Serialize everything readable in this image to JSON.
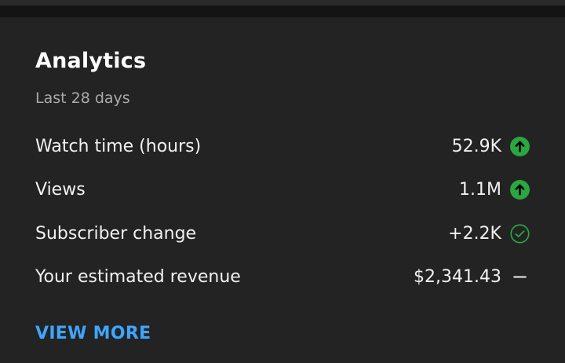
{
  "card": {
    "title": "Analytics",
    "subtitle": "Last 28 days",
    "view_more_label": "VIEW MORE"
  },
  "metrics": [
    {
      "label": "Watch time (hours)",
      "value": "52.9K",
      "indicator": "arrow-up-icon"
    },
    {
      "label": "Views",
      "value": "1.1M",
      "indicator": "arrow-up-icon"
    },
    {
      "label": "Subscriber change",
      "value": "+2.2K",
      "indicator": "check-circle-icon"
    },
    {
      "label": "Your estimated revenue",
      "value": "$2,341.43",
      "indicator": "dash-icon"
    }
  ],
  "colors": {
    "background": "#212121",
    "text_primary": "#f1f1f1",
    "text_secondary": "#aaaaaa",
    "positive": "#2ba640",
    "link": "#3ea6ff"
  }
}
